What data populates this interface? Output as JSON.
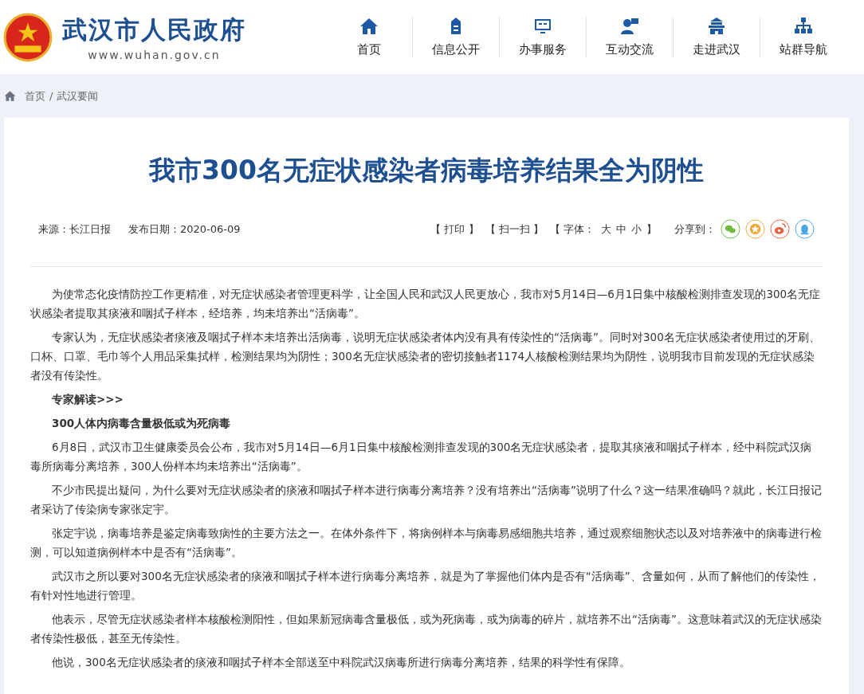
{
  "header": {
    "site_name": "武汉市人民政府",
    "site_url": "www.wuhan.gov.cn",
    "nav": [
      {
        "label": "首页",
        "kind": "home"
      },
      {
        "label": "信息公开",
        "kind": "info"
      },
      {
        "label": "办事服务",
        "kind": "screen"
      },
      {
        "label": "互动交流",
        "kind": "chat"
      },
      {
        "label": "走进武汉",
        "kind": "tower"
      },
      {
        "label": "站群导航",
        "kind": "tree"
      }
    ]
  },
  "breadcrumb": {
    "items": [
      "首页",
      "武汉要闻"
    ],
    "separator": "/"
  },
  "article": {
    "title": "我市300名无症状感染者病毒培养结果全为阴性",
    "source": "来源：长江日报",
    "date": "发布日期：2020-06-09",
    "tools": [
      "【 打印 】",
      "【 扫一扫 】"
    ],
    "font_label": "【 字体：",
    "font_sizes": [
      "大",
      "中",
      "小"
    ],
    "font_close": "】",
    "share_label": "分享到：",
    "body": [
      {
        "kind": "para",
        "text": "为使常态化疫情防控工作更精准，对无症状感染者管理更科学，让全国人民和武汉人民更放心，我市对5月14日—6月1日集中核酸检测排查发现的300名无症状感染者提取其痰液和咽拭子样本，经培养，均未培养出“活病毒”。"
      },
      {
        "kind": "para",
        "text": "专家认为，无症状感染者痰液及咽拭子样本未培养出活病毒，说明无症状感染者体内没有具有传染性的“活病毒”。同时对300名无症状感染者使用过的牙刷、口杯、口罩、毛巾等个人用品采集拭样，检测结果均为阴性；300名无症状感染者的密切接触者1174人核酸检测结果均为阴性，说明我市目前发现的无症状感染者没有传染性。"
      },
      {
        "kind": "heading",
        "text": "专家解读>>>"
      },
      {
        "kind": "heading",
        "text": "300人体内病毒含量极低或为死病毒"
      },
      {
        "kind": "para",
        "text": "6月8日，武汉市卫生健康委员会公布，我市对5月14日—6月1日集中核酸检测排查发现的300名无症状感染者，提取其痰液和咽拭子样本，经中科院武汉病毒所病毒分离培养，300人份样本均未培养出“活病毒”。"
      },
      {
        "kind": "para",
        "text": "不少市民提出疑问，为什么要对无症状感染者的痰液和咽拭子样本进行病毒分离培养？没有培养出“活病毒”说明了什么？这一结果准确吗？就此，长江日报记者采访了传染病专家张定宇。"
      },
      {
        "kind": "para",
        "text": "张定宇说，病毒培养是鉴定病毒致病性的主要方法之一。在体外条件下，将病例样本与病毒易感细胞共培养，通过观察细胞状态以及对培养液中的病毒进行检测，可以知道病例样本中是否有“活病毒”。"
      },
      {
        "kind": "para",
        "text": "武汉市之所以要对300名无症状感染者的痰液和咽拭子样本进行病毒分离培养，就是为了掌握他们体内是否有“活病毒”、含量如何，从而了解他们的传染性，有针对性地进行管理。"
      },
      {
        "kind": "para",
        "text": "他表示，尽管无症状感染者样本核酸检测阳性，但如果新冠病毒含量极低，或为死病毒，或为病毒的碎片，就培养不出“活病毒”。这意味着武汉的无症状感染者传染性极低，甚至无传染性。"
      },
      {
        "kind": "para",
        "text": "他说，300名无症状感染者的痰液和咽拭子样本全部送至中科院武汉病毒所进行病毒分离培养，结果的科学性有保障。"
      }
    ]
  }
}
